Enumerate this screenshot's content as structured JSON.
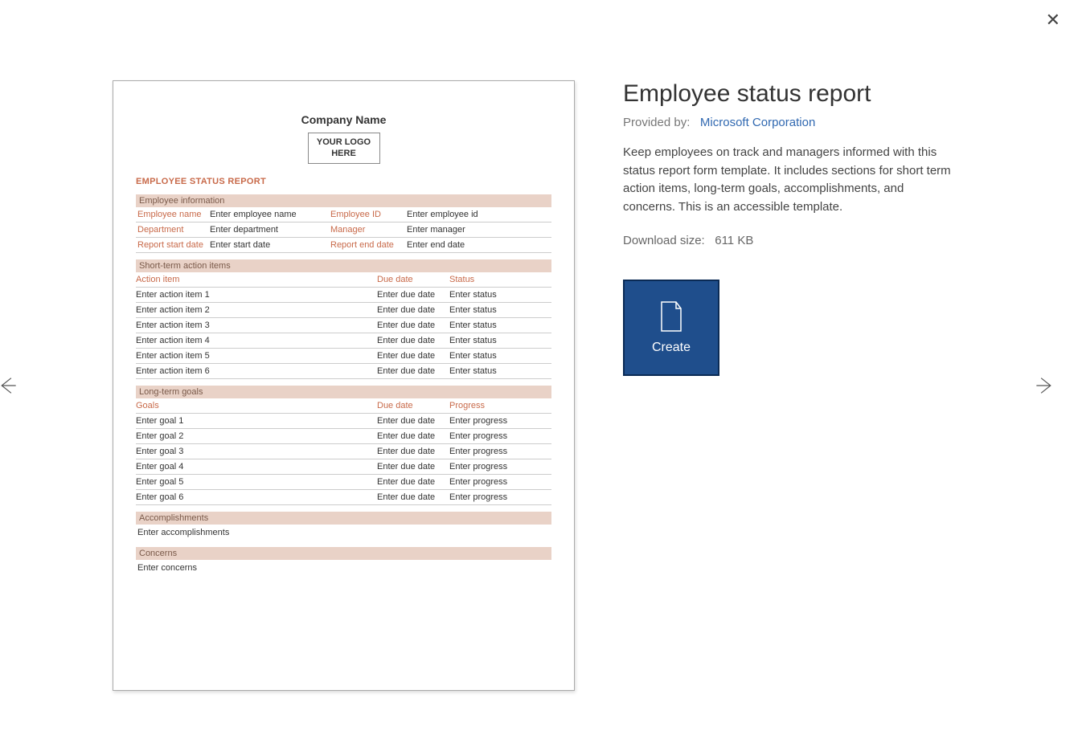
{
  "close_label": "✕",
  "nav_prev": "←",
  "nav_next": "→",
  "details": {
    "title": "Employee status report",
    "provided_label": "Provided by:",
    "provider": "Microsoft Corporation",
    "description": "Keep employees on track and managers informed with this status report form template. It includes sections for short term action items, long-term goals, accomplishments, and concerns. This is an accessible template.",
    "download_label": "Download size:",
    "download_value": "611 KB",
    "create_label": "Create"
  },
  "preview": {
    "company": "Company Name",
    "logo_text": "YOUR LOGO HERE",
    "report_title": "EMPLOYEE STATUS REPORT",
    "info_header": "Employee information",
    "info_rows": [
      [
        "Employee name",
        "Enter employee name",
        "Employee ID",
        "Enter employee id"
      ],
      [
        "Department",
        "Enter department",
        "Manager",
        "Enter manager"
      ],
      [
        "Report start date",
        "Enter start date",
        "Report end date",
        "Enter end date"
      ]
    ],
    "short_header": "Short-term action items",
    "short_cols": [
      "Action item",
      "Due date",
      "Status"
    ],
    "short_rows": [
      [
        "Enter action item 1",
        "Enter due date",
        "Enter status"
      ],
      [
        "Enter action item 2",
        "Enter due date",
        "Enter status"
      ],
      [
        "Enter action item 3",
        "Enter due date",
        "Enter status"
      ],
      [
        "Enter action item 4",
        "Enter due date",
        "Enter status"
      ],
      [
        "Enter action item 5",
        "Enter due date",
        "Enter status"
      ],
      [
        "Enter action item 6",
        "Enter due date",
        "Enter status"
      ]
    ],
    "long_header": "Long-term goals",
    "long_cols": [
      "Goals",
      "Due date",
      "Progress"
    ],
    "long_rows": [
      [
        "Enter goal 1",
        "Enter due date",
        "Enter progress"
      ],
      [
        "Enter goal 2",
        "Enter due date",
        "Enter progress"
      ],
      [
        "Enter goal 3",
        "Enter due date",
        "Enter progress"
      ],
      [
        "Enter goal 4",
        "Enter due date",
        "Enter progress"
      ],
      [
        "Enter goal 5",
        "Enter due date",
        "Enter progress"
      ],
      [
        "Enter goal 6",
        "Enter due date",
        "Enter progress"
      ]
    ],
    "acc_header": "Accomplishments",
    "acc_text": "Enter accomplishments",
    "con_header": "Concerns",
    "con_text": "Enter concerns"
  }
}
